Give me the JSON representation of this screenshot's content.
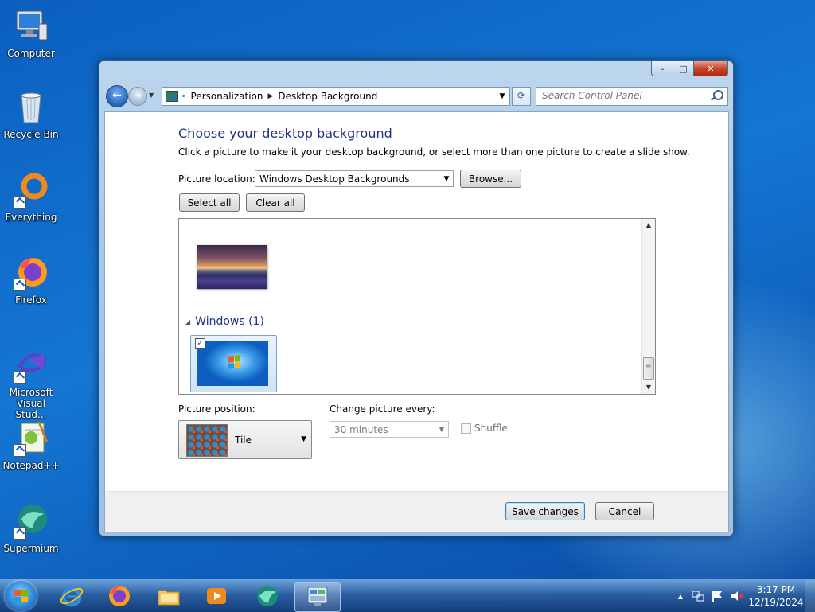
{
  "desktop": {
    "icons": [
      {
        "label": "Computer",
        "icon": "computer-icon"
      },
      {
        "label": "Recycle Bin",
        "icon": "recycle-bin-icon"
      },
      {
        "label": "Everything",
        "icon": "everything-search-icon"
      },
      {
        "label": "Firefox",
        "icon": "firefox-icon"
      },
      {
        "label": "Microsoft Visual Stud...",
        "icon": "visual-studio-icon"
      },
      {
        "label": "Notepad++",
        "icon": "notepad-plus-plus-icon"
      },
      {
        "label": "Supermium",
        "icon": "supermium-icon"
      }
    ]
  },
  "window": {
    "controls": {
      "minimize": "–",
      "maximize": "□",
      "close": "✕"
    },
    "nav": {
      "back": "←",
      "forward": "→",
      "refresh": "⟳"
    },
    "breadcrumb": {
      "prefix": "«",
      "items": [
        "Personalization",
        "Desktop Background"
      ]
    },
    "search": {
      "placeholder": "Search Control Panel"
    }
  },
  "content": {
    "title": "Choose your desktop background",
    "subtitle": "Click a picture to make it your desktop background, or select more than one picture to create a slide show.",
    "picture_location_label": "Picture location:",
    "picture_location_value": "Windows Desktop Backgrounds",
    "browse_label": "Browse...",
    "select_all_label": "Select all",
    "clear_all_label": "Clear all",
    "gallery": {
      "group_title": "Windows (1)",
      "selected_checkbox": "✓"
    },
    "picture_position_label": "Picture position:",
    "picture_position_value": "Tile",
    "change_picture_label": "Change picture every:",
    "change_picture_value": "30 minutes",
    "shuffle_label": "Shuffle",
    "save_label": "Save changes",
    "cancel_label": "Cancel"
  },
  "taskbar": {
    "apps": [
      "internet-explorer-icon",
      "firefox-icon",
      "file-explorer-icon",
      "media-player-icon",
      "supermium-icon",
      "control-panel-icon"
    ],
    "clock": {
      "time": "3:17 PM",
      "date": "12/19/2024"
    }
  },
  "colors": {
    "desktop_blue": "#1576d3",
    "title_text": "#1e3287",
    "close_button": "#c8462c"
  }
}
